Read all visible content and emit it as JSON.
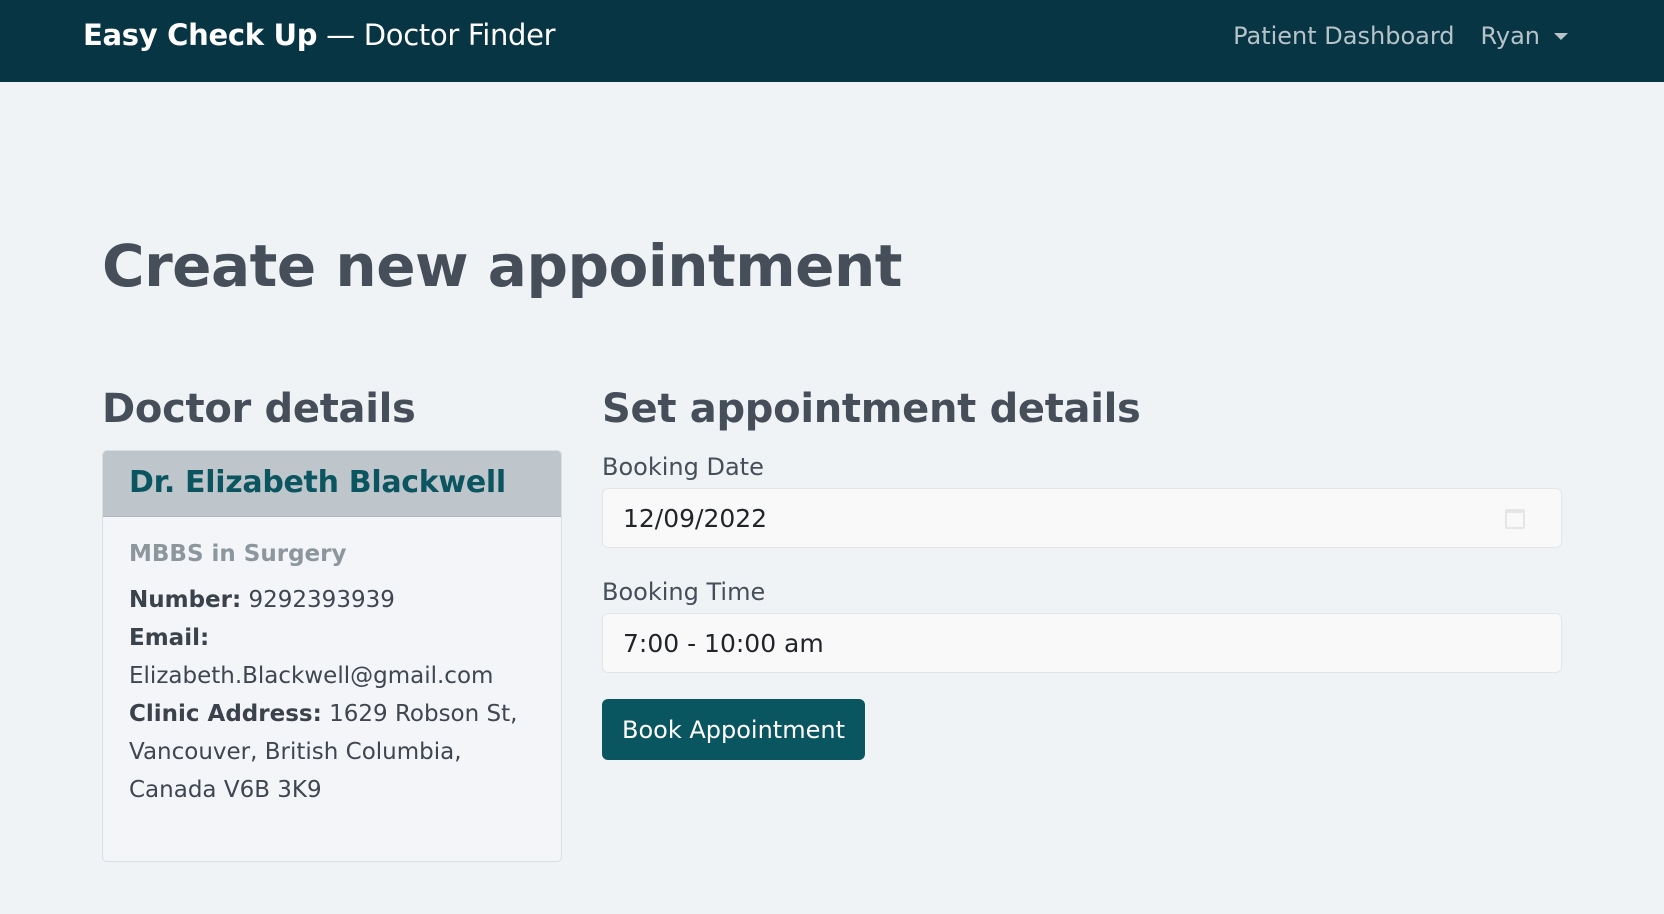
{
  "navbar": {
    "brand_bold": "Easy Check Up",
    "brand_rest": " — Doctor Finder",
    "dashboard_link": "Patient Dashboard",
    "user_name": "Ryan"
  },
  "page": {
    "title": "Create new appointment"
  },
  "doctor": {
    "heading": "Doctor details",
    "name": "Dr. Elizabeth Blackwell",
    "qualification": "MBBS in Surgery",
    "number_label": "Number:",
    "number": "9292393939",
    "email_label": "Email:",
    "email": "Elizabeth.Blackwell@gmail.com",
    "address_label": "Clinic Address:",
    "address_line1": "1629 Robson St,",
    "address_line2": "Vancouver, British Columbia,",
    "address_line3": "Canada V6B 3K9"
  },
  "appointment": {
    "heading": "Set appointment details",
    "date_label": "Booking Date",
    "date_value": "12/09/2022",
    "time_label": "Booking Time",
    "time_value": "7:00 - 10:00 am",
    "book_button": "Book Appointment"
  },
  "icons": {
    "calendar": "calendar-icon",
    "user_menu_caret": "chevron-down-icon"
  },
  "colors": {
    "navbar_bg": "#083544",
    "page_bg": "#f0f3f6",
    "accent": "#095560",
    "doctor_name": "#0a5560",
    "card_header_bg": "#bec5cb"
  }
}
